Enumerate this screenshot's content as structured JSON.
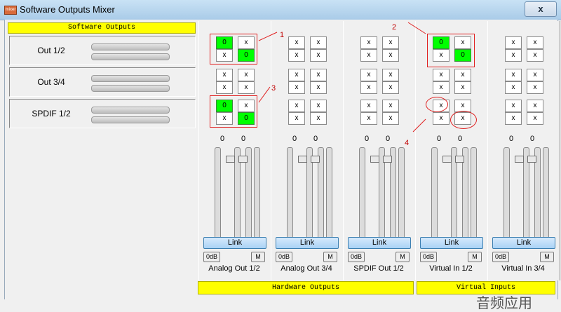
{
  "window": {
    "title": "Software Outputs Mixer",
    "app_icon_text": "mixer",
    "close_label": "x"
  },
  "software_outputs": {
    "header": "Software Outputs",
    "rows": [
      {
        "label": "Out 1/2"
      },
      {
        "label": "Out 3/4"
      },
      {
        "label": "SPDIF 1/2"
      }
    ]
  },
  "strips": [
    {
      "name": "Analog Out 1/2",
      "levels": [
        "0",
        "0"
      ],
      "link": "Link",
      "zero": "0dB",
      "mute": "M",
      "cells": [
        [
          "0",
          "x",
          "x",
          "0"
        ],
        [
          "x",
          "x",
          "x",
          "x"
        ],
        [
          "0",
          "x",
          "x",
          "0"
        ]
      ],
      "active": [
        [
          true,
          false,
          false,
          true
        ],
        [
          false,
          false,
          false,
          false
        ],
        [
          true,
          false,
          false,
          true
        ]
      ]
    },
    {
      "name": "Analog Out 3/4",
      "levels": [
        "0",
        "0"
      ],
      "link": "Link",
      "zero": "0dB",
      "mute": "M",
      "cells": [
        [
          "x",
          "x",
          "x",
          "x"
        ],
        [
          "x",
          "x",
          "x",
          "x"
        ],
        [
          "x",
          "x",
          "x",
          "x"
        ]
      ],
      "active": [
        [
          false,
          false,
          false,
          false
        ],
        [
          false,
          false,
          false,
          false
        ],
        [
          false,
          false,
          false,
          false
        ]
      ]
    },
    {
      "name": "SPDIF Out 1/2",
      "levels": [
        "0",
        "0"
      ],
      "link": "Link",
      "zero": "0dB",
      "mute": "M",
      "cells": [
        [
          "x",
          "x",
          "x",
          "x"
        ],
        [
          "x",
          "x",
          "x",
          "x"
        ],
        [
          "x",
          "x",
          "x",
          "x"
        ]
      ],
      "active": [
        [
          false,
          false,
          false,
          false
        ],
        [
          false,
          false,
          false,
          false
        ],
        [
          false,
          false,
          false,
          false
        ]
      ]
    },
    {
      "name": "Virtual In 1/2",
      "levels": [
        "0",
        "0"
      ],
      "link": "Link",
      "zero": "0dB",
      "mute": "M",
      "cells": [
        [
          "0",
          "x",
          "x",
          "0"
        ],
        [
          "x",
          "x",
          "x",
          "x"
        ],
        [
          "x",
          "x",
          "x",
          "x"
        ]
      ],
      "active": [
        [
          true,
          false,
          false,
          true
        ],
        [
          false,
          false,
          false,
          false
        ],
        [
          false,
          false,
          false,
          false
        ]
      ]
    },
    {
      "name": "Virtual In 3/4",
      "levels": [
        "0",
        "0"
      ],
      "link": "Link",
      "zero": "0dB",
      "mute": "M",
      "cells": [
        [
          "x",
          "x",
          "x",
          "x"
        ],
        [
          "x",
          "x",
          "x",
          "x"
        ],
        [
          "x",
          "x",
          "x",
          "x"
        ]
      ],
      "active": [
        [
          false,
          false,
          false,
          false
        ],
        [
          false,
          false,
          false,
          false
        ],
        [
          false,
          false,
          false,
          false
        ]
      ]
    }
  ],
  "hardware_outputs_header": "Hardware Outputs",
  "virtual_inputs_header": "Virtual Inputs",
  "annotations": [
    "1",
    "2",
    "3",
    "4"
  ],
  "watermark": "音频应用",
  "colors": {
    "active_cell": "#00ff00",
    "header": "#ffff00",
    "annotation": "#e02020"
  }
}
